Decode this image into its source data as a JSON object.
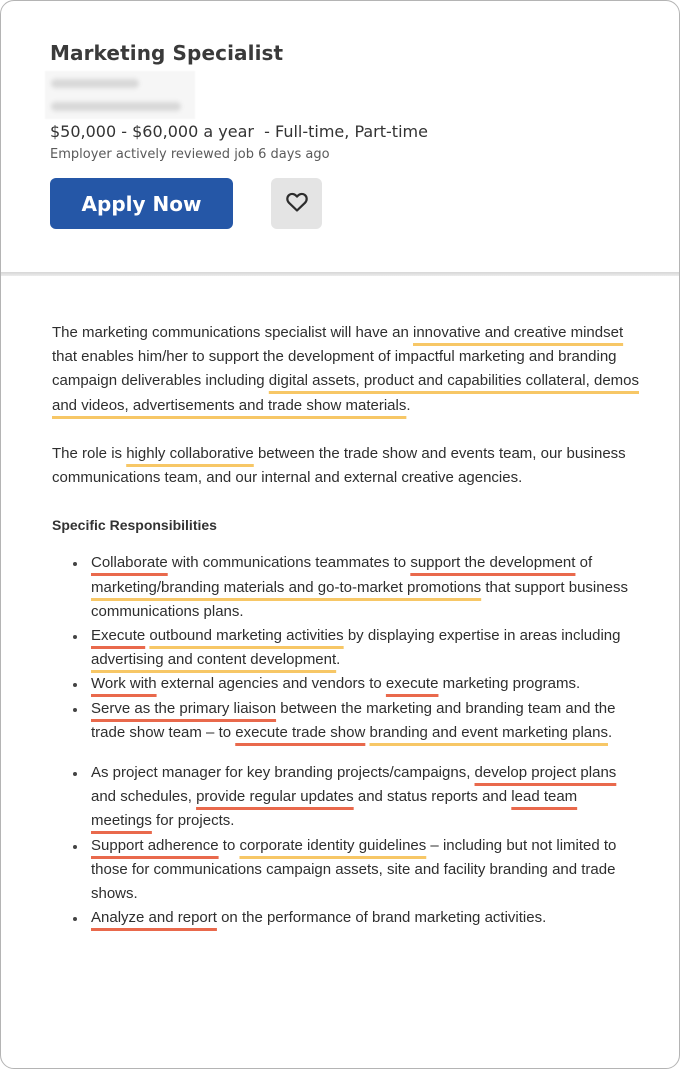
{
  "job": {
    "title": "Marketing Specialist",
    "company_redacted": true,
    "location_redacted": true,
    "salary": "$50,000 - $60,000 a year",
    "job_type": "  - Full-time, Part-time",
    "reviewed": "Employer actively reviewed job 6 days ago"
  },
  "actions": {
    "apply_label": "Apply Now",
    "save_icon": "heart-icon"
  },
  "colors": {
    "apply_bg": "#2557a7",
    "highlight_yellow": "#f7c766",
    "highlight_red": "#e9694c"
  },
  "description": {
    "p1": [
      {
        "t": "The marketing communications specialist will have an "
      },
      {
        "t": "innovative and creative mindset",
        "h": "y"
      },
      {
        "t": " that enables him/her to support the development of impactful marketing and branding campaign deliverables including "
      },
      {
        "t": "digital assets, product and capabilities collateral, demos and videos, advertisements and trade show materials",
        "h": "y"
      },
      {
        "t": "."
      }
    ],
    "p2": [
      {
        "t": "The role is "
      },
      {
        "t": "highly collaborative",
        "h": "y"
      },
      {
        "t": " between the trade show and events team, our business communications team, and our internal and external creative agencies."
      }
    ],
    "responsibilities_heading": "Specific Responsibilities",
    "responsibilities_group1": [
      [
        {
          "t": "Collaborate",
          "h": "r"
        },
        {
          "t": " with communications teammates to "
        },
        {
          "t": "support the development",
          "h": "r"
        },
        {
          "t": " of "
        },
        {
          "t": "marketing/branding materials and go-to-market promotions",
          "h": "y"
        },
        {
          "t": " that support business communications plans."
        }
      ],
      [
        {
          "t": "Execute",
          "h": "r"
        },
        {
          "t": " "
        },
        {
          "t": "outbound marketing activities",
          "h": "y"
        },
        {
          "t": " by displaying expertise in areas including "
        },
        {
          "t": "advertising and content development",
          "h": "y"
        },
        {
          "t": "."
        }
      ],
      [
        {
          "t": "Work with",
          "h": "r"
        },
        {
          "t": " external agencies and vendors to "
        },
        {
          "t": "execute",
          "h": "r"
        },
        {
          "t": " marketing programs."
        }
      ],
      [
        {
          "t": "Serve as the primary liaison",
          "h": "r"
        },
        {
          "t": " between the marketing and branding team and the trade show team – to "
        },
        {
          "t": "execute trade show",
          "h": "r"
        },
        {
          "t": " "
        },
        {
          "t": "branding and event marketing plans",
          "h": "y"
        },
        {
          "t": "."
        }
      ]
    ],
    "responsibilities_group2": [
      [
        {
          "t": "As project manager for key branding projects/campaigns, "
        },
        {
          "t": "develop project plans",
          "h": "r"
        },
        {
          "t": " and schedules, "
        },
        {
          "t": "provide regular updates",
          "h": "r"
        },
        {
          "t": " and status reports and "
        },
        {
          "t": "lead team meetings",
          "h": "r"
        },
        {
          "t": " for projects."
        }
      ],
      [
        {
          "t": "Support adherence",
          "h": "r"
        },
        {
          "t": " to "
        },
        {
          "t": "corporate identity guidelines",
          "h": "y"
        },
        {
          "t": " – including but not limited to those for communications campaign assets, site and facility branding and trade shows."
        }
      ],
      [
        {
          "t": "Analyze and report",
          "h": "r"
        },
        {
          "t": " on the performance of brand marketing activities."
        }
      ]
    ]
  }
}
